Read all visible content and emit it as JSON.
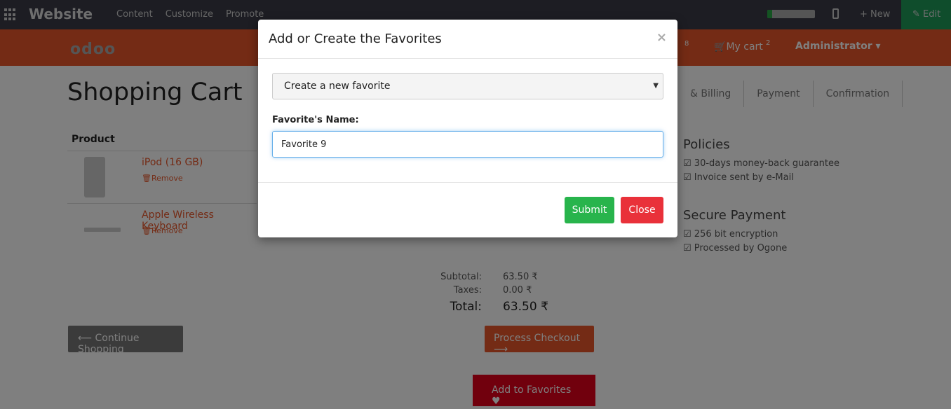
{
  "topbar": {
    "brand": "Website",
    "menu": [
      "Content",
      "Customize",
      "Promote"
    ],
    "progress_fraction": 0.1,
    "new_label": "New",
    "edit_label": "Edit",
    "apps_icon": "apps-grid-icon",
    "mobile_icon": "mobile-icon"
  },
  "header": {
    "logo": "odoo",
    "wishlist_count": "8",
    "cart_label": "My cart",
    "cart_count": "2",
    "user_label": "Administrator"
  },
  "page": {
    "title": "Shopping Cart",
    "steps": [
      "& Billing",
      "Payment",
      "Confirmation"
    ],
    "product_header": "Product",
    "products": [
      {
        "name": "iPod (16 GB)",
        "remove": "Remove"
      },
      {
        "name": "Apple Wireless Keyboard",
        "remove": "Remove"
      }
    ],
    "policies": {
      "title": "Policies",
      "items": [
        "30-days money-back guarantee",
        "Invoice sent by e-Mail"
      ]
    },
    "secure": {
      "title": "Secure Payment",
      "items": [
        "256 bit encryption",
        "Processed by Ogone"
      ]
    },
    "totals": {
      "subtotal_label": "Subtotal:",
      "subtotal_value": "63.50 ₹",
      "taxes_label": "Taxes:",
      "taxes_value": "0.00 ₹",
      "total_label": "Total:",
      "total_value": "63.50 ₹"
    },
    "continue_label": "Continue Shopping",
    "checkout_label": "Process Checkout",
    "favorites_label": "Add to Favorites"
  },
  "modal": {
    "title": "Add or Create the Favorites",
    "close_symbol": "×",
    "select_value": "Create a new favorite",
    "field_label": "Favorite's Name:",
    "name_value": "Favorite 9",
    "submit_label": "Submit",
    "close_label": "Close"
  },
  "colors": {
    "topbar": "#3a3b47",
    "header": "#e8572a",
    "edit": "#1f9a58",
    "submit": "#28b44c",
    "close": "#e9313a",
    "favorites": "#e3001b"
  }
}
